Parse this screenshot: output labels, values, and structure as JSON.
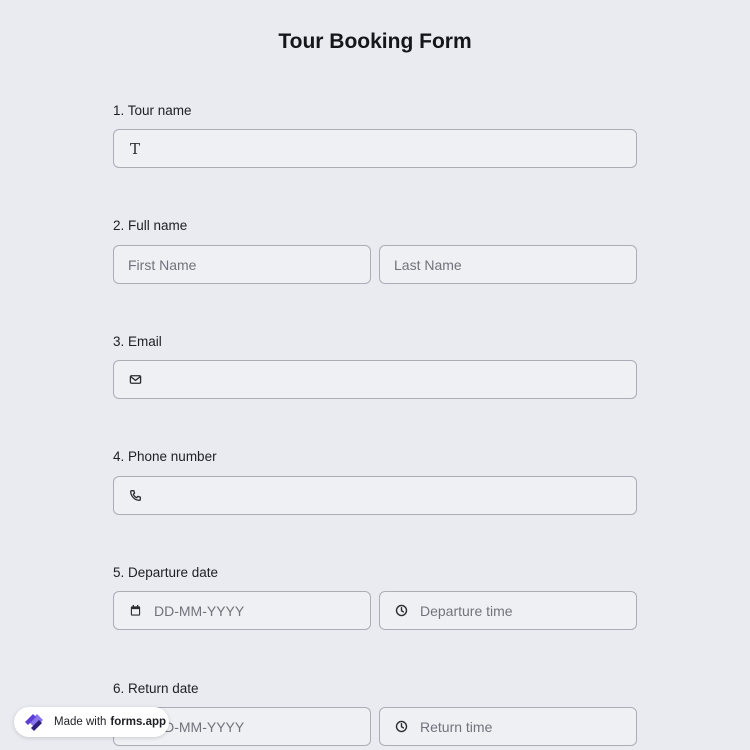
{
  "form": {
    "title": "Tour Booking Form"
  },
  "questions": [
    {
      "label": "1.  Tour name"
    },
    {
      "label": "2. Full name",
      "first_placeholder": "First Name",
      "last_placeholder": "Last Name"
    },
    {
      "label": "3. Email"
    },
    {
      "label": "4. Phone number"
    },
    {
      "label": "5. Departure date",
      "date_placeholder": "DD-MM-YYYY",
      "time_placeholder": "Departure time"
    },
    {
      "label": "6. Return date",
      "date_placeholder": "DD-MM-YYYY",
      "time_placeholder": "Return time"
    }
  ],
  "icons": {
    "text": "T",
    "email": "envelope-icon",
    "phone": "phone-icon",
    "calendar": "calendar-icon",
    "clock": "clock-icon"
  },
  "badge": {
    "prefix": "Made with",
    "brand": "forms.app",
    "logo": "forms-app-logo"
  },
  "colors": {
    "background": "#e9ebf1",
    "field_bg": "#eff0f4",
    "field_border": "#a9adb6",
    "logo_primary": "#5b3fd6"
  }
}
